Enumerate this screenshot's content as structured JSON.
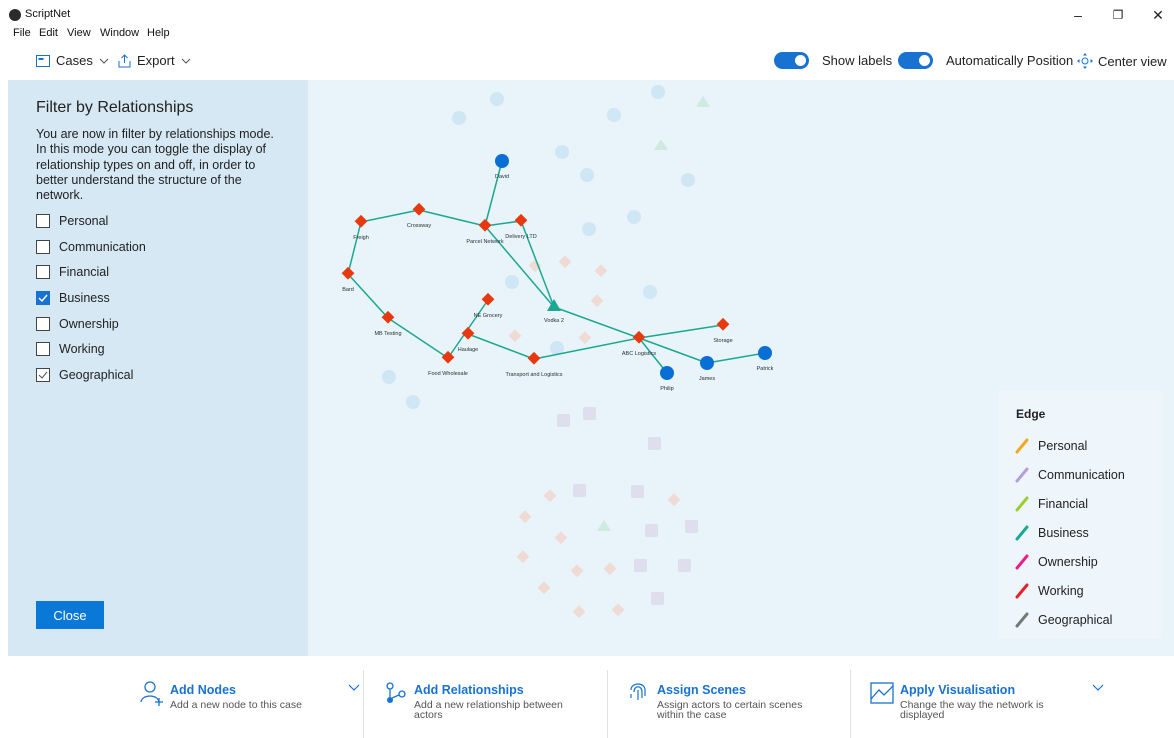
{
  "app": {
    "title": "ScriptNet"
  },
  "window": {
    "minimize": "–",
    "restore": "❐",
    "close": "✕"
  },
  "menu": [
    "File",
    "Edit",
    "View",
    "Window",
    "Help"
  ],
  "toolbar": {
    "cases_label": "Cases",
    "export_label": "Export",
    "show_labels": "Show labels",
    "auto_position": "Automatically Position",
    "center_view": "Center view"
  },
  "filter_panel": {
    "title": "Filter by Relationships",
    "description": "You are now in filter by relationships mode. In this mode you can toggle the display of relationship types on and off, in order to better understand the structure of the network.",
    "options": [
      {
        "label": "Personal",
        "checked": false
      },
      {
        "label": "Communication",
        "checked": false
      },
      {
        "label": "Financial",
        "checked": false
      },
      {
        "label": "Business",
        "checked": true
      },
      {
        "label": "Ownership",
        "checked": false
      },
      {
        "label": "Working",
        "checked": false
      },
      {
        "label": "Geographical",
        "checked": "partial"
      }
    ],
    "close_label": "Close"
  },
  "graph": {
    "active_nodes": [
      {
        "label": "David"
      },
      {
        "label": "Freigh"
      },
      {
        "label": "Crossway"
      },
      {
        "label": "Parcel Network"
      },
      {
        "label": "Delivery LTD"
      },
      {
        "label": "Bard"
      },
      {
        "label": "NE Grocery"
      },
      {
        "label": "Vodka 2"
      },
      {
        "label": "MB Testing"
      },
      {
        "label": "Haulage"
      },
      {
        "label": "Storage"
      },
      {
        "label": "ABC Logistics"
      },
      {
        "label": "Food Wholesale"
      },
      {
        "label": "Transport and Logistics"
      },
      {
        "label": "Patrick"
      },
      {
        "label": "James"
      },
      {
        "label": "Philip"
      }
    ]
  },
  "legend": {
    "title": "Edge",
    "items": [
      {
        "label": "Personal",
        "color": "#f5a623"
      },
      {
        "label": "Communication",
        "color": "#b39ddb"
      },
      {
        "label": "Financial",
        "color": "#9acd32"
      },
      {
        "label": "Business",
        "color": "#1aa890"
      },
      {
        "label": "Ownership",
        "color": "#e91e8c"
      },
      {
        "label": "Working",
        "color": "#e8202a"
      },
      {
        "label": "Geographical",
        "color": "#777777"
      }
    ]
  },
  "actions": [
    {
      "title": "Add Nodes",
      "desc": "Add a new node to this case",
      "icon": "add-person-icon"
    },
    {
      "title": "Add Relationships",
      "desc": "Add a new relationship between actors",
      "icon": "relationship-icon"
    },
    {
      "title": "Assign Scenes",
      "desc": "Assign actors to certain scenes within the case",
      "icon": "fingerprint-icon"
    },
    {
      "title": "Apply Visualisation",
      "desc": "Change the way the network is displayed",
      "icon": "visualisation-icon"
    }
  ],
  "colors": {
    "accent": "#1872d1",
    "business_edge": "#1aa890",
    "org_node": "#e8380d",
    "person_node": "#0a6fd4"
  }
}
